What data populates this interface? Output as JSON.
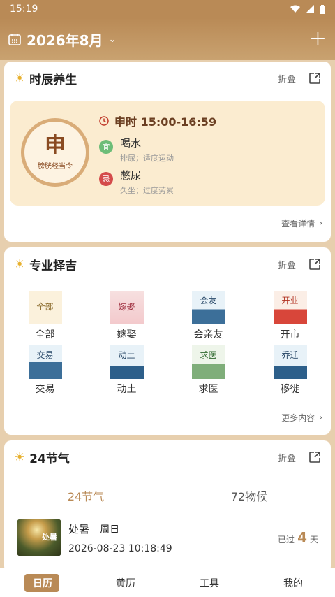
{
  "status": {
    "time": "15:19"
  },
  "header": {
    "title": "2026年8月"
  },
  "shichen": {
    "title": "时辰养生",
    "fold": "折叠",
    "branch": "申",
    "meridian": "膀胱经当令",
    "time_range": "申时 15:00-16:59",
    "yi": {
      "badge": "宜",
      "main": "喝水",
      "sub": "排尿；适度运动"
    },
    "ji": {
      "badge": "忌",
      "main": "憋尿",
      "sub": "久坐；过度劳累"
    },
    "more": "查看详情"
  },
  "zeji": {
    "title": "专业择吉",
    "fold": "折叠",
    "items": [
      {
        "label": "全部",
        "tile": "全部"
      },
      {
        "label": "嫁娶",
        "tile": "嫁娶"
      },
      {
        "label": "会亲友",
        "tile": "会友"
      },
      {
        "label": "开市",
        "tile": "开业"
      },
      {
        "label": "交易",
        "tile": "交易"
      },
      {
        "label": "动土",
        "tile": "动土"
      },
      {
        "label": "求医",
        "tile": "求医"
      },
      {
        "label": "移徙",
        "tile": "乔迁"
      }
    ],
    "more": "更多内容"
  },
  "solar": {
    "title": "24节气",
    "fold": "折叠",
    "tabs": [
      "24节气",
      "72物候"
    ],
    "term": "处暑",
    "weekday": "周日",
    "datetime": "2026-08-23 10:18:49",
    "thumb_text": "处暑",
    "passed_prefix": "已过",
    "passed_days": "4",
    "passed_suffix": "天"
  },
  "nav": [
    "日历",
    "黄历",
    "工具",
    "我的"
  ],
  "colors": {
    "accent": "#b98a56",
    "yi": "#6dbd78",
    "ji": "#d44b4b"
  }
}
